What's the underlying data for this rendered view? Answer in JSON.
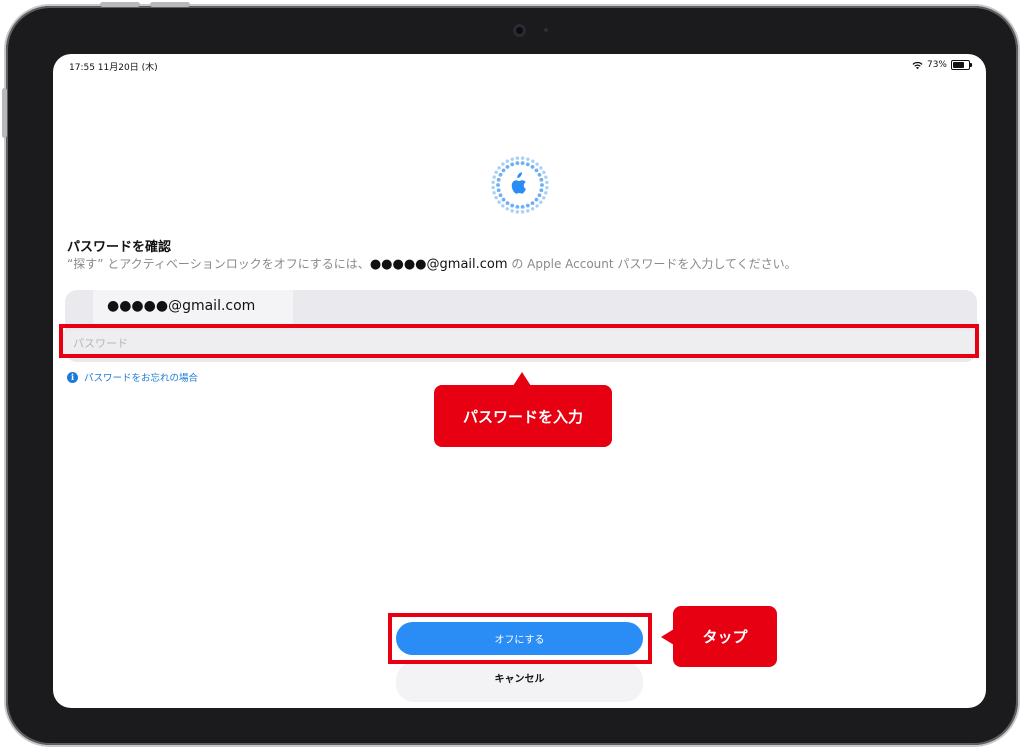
{
  "status_bar": {
    "time_date": "17:55  11月20日 (木)",
    "battery_percent": "73%",
    "battery_level": 0.73,
    "wifi_icon": "wifi-icon"
  },
  "header": {
    "icon": "apple-findmy-icon",
    "title": "パスワードを確認",
    "desc_prefix": "“探す” とアクティベーションロックをオフにするには、",
    "desc_email": "●●●●●@gmail.com",
    "desc_suffix": " の Apple Account パスワードを入力してください。"
  },
  "form": {
    "account": "●●●●●@gmail.com",
    "password_placeholder": "パスワード",
    "password_value": "",
    "forgot_link": "パスワードをお忘れの場合"
  },
  "actions": {
    "turn_off_label": "オフにする",
    "cancel_label": "キャンセル"
  },
  "annotations": {
    "password_callout": "パスワードを入力",
    "tap_callout": "タップ"
  },
  "colors": {
    "accent": "#2a8cf5",
    "highlight_red": "#e60012",
    "link_blue": "#1e7ad6"
  }
}
